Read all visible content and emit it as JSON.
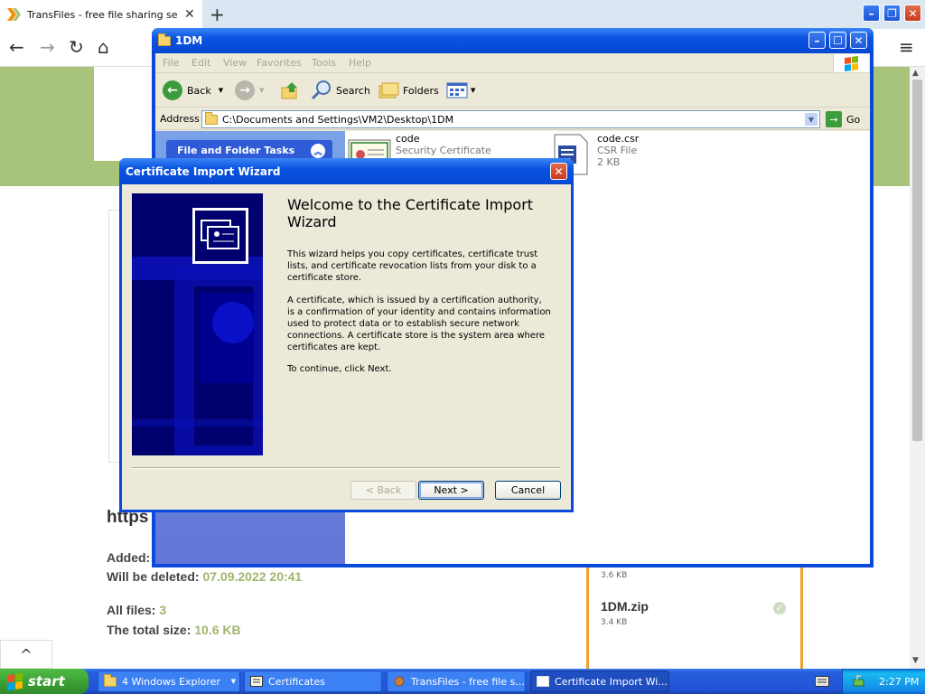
{
  "browser": {
    "tab_title": "TransFiles - free file sharing servic",
    "tab_close": "✕",
    "new_tab": "+",
    "nav": {
      "back": "←",
      "forward": "→",
      "reload": "↻",
      "home": "⌂",
      "menu": "≡"
    }
  },
  "website": {
    "url_heading": "https",
    "added_label": "Added:",
    "deleted_label": "Will be deleted:",
    "deleted_value": "07.09.2022 20:41",
    "all_files_label": "All files:",
    "all_files_value": "3",
    "total_size_label": "The total size:",
    "total_size_value": "10.6 KB",
    "files": [
      {
        "size": "3.6 KB"
      },
      {
        "name": "1DM.zip",
        "size": "3.4 KB"
      }
    ],
    "scroll_up": "^",
    "accent_color": "#a7c47a",
    "logo_color": "#f39200",
    "card_border_color": "#f0a030"
  },
  "explorer": {
    "title": "1DM",
    "menu": [
      "File",
      "Edit",
      "View",
      "Favorites",
      "Tools",
      "Help"
    ],
    "toolbar": {
      "back": "Back",
      "search": "Search",
      "folders": "Folders"
    },
    "address_label": "Address",
    "address_value": "C:\\Documents and Settings\\VM2\\Desktop\\1DM",
    "go_label": "Go",
    "task_pane_header": "File and Folder Tasks",
    "files": [
      {
        "name": "code",
        "type": "Security Certificate",
        "icon": "certificate-icon"
      },
      {
        "name": "code.csr",
        "type": "CSR File",
        "size": "2 KB",
        "icon": "csr-file-icon"
      }
    ]
  },
  "wizard": {
    "title": "Certificate Import Wizard",
    "heading": "Welcome to the Certificate Import Wizard",
    "paragraphs": [
      "This wizard helps you copy certificates, certificate trust lists, and certificate revocation lists from your disk to a certificate store.",
      "A certificate, which is issued by a certification authority, is a confirmation of your identity and contains information used to protect data or to establish secure network connections. A certificate store is the system area where certificates are kept.",
      "To continue, click Next."
    ],
    "buttons": {
      "back": "< Back",
      "next": "Next >",
      "cancel": "Cancel"
    }
  },
  "taskbar": {
    "start": "start",
    "items": [
      {
        "label": "4 Windows Explorer",
        "icon": "folder-icon"
      },
      {
        "label": "Certificates",
        "icon": "certificates-icon"
      },
      {
        "label": "TransFiles - free file s...",
        "icon": "browser-icon"
      },
      {
        "label": "Certificate Import Wi...",
        "icon": "window-icon"
      }
    ],
    "clock": "2:27 PM"
  }
}
